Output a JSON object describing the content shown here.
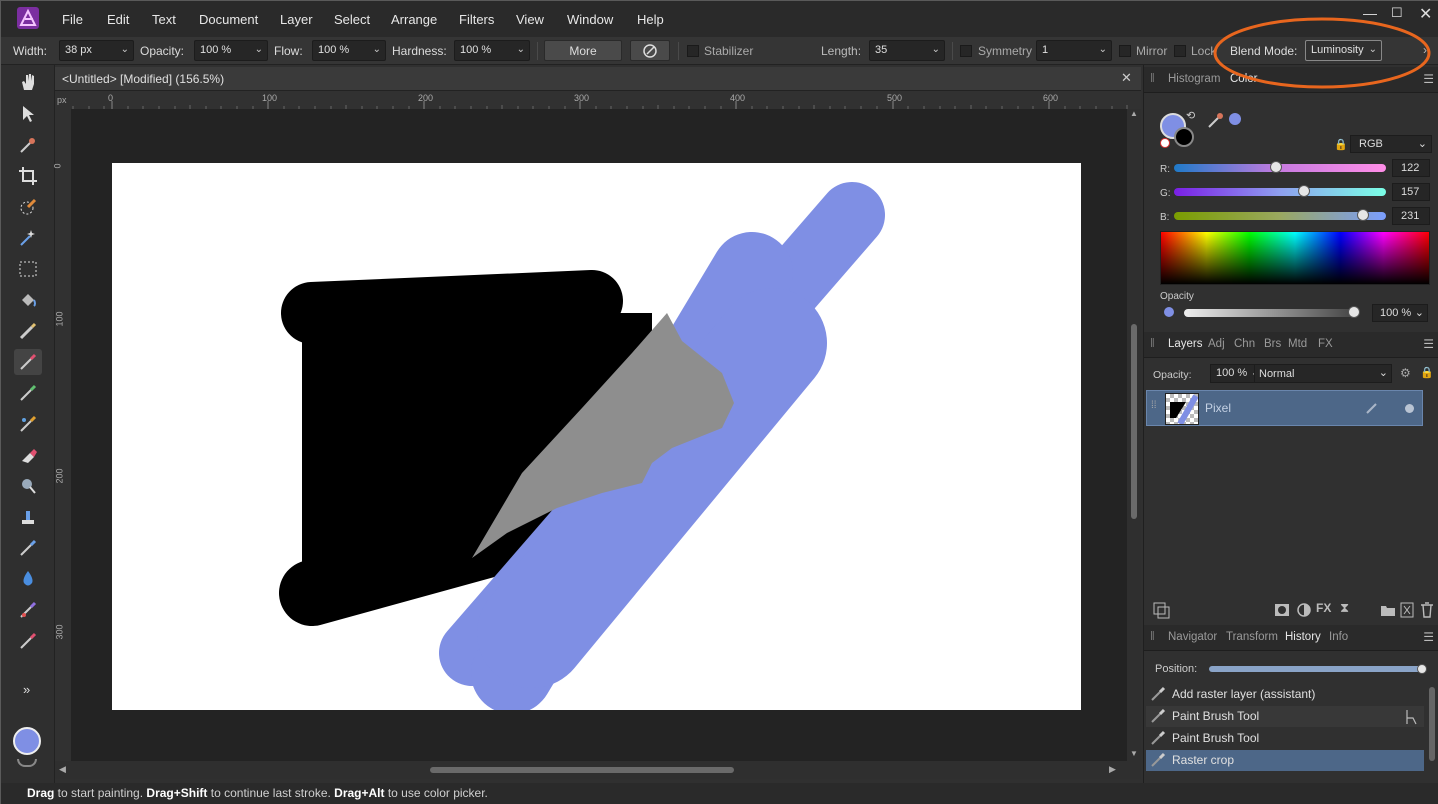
{
  "menubar": {
    "items": [
      "File",
      "Edit",
      "Text",
      "Document",
      "Layer",
      "Select",
      "Arrange",
      "Filters",
      "View",
      "Window",
      "Help"
    ],
    "mnemonics": [
      "F",
      "E",
      "T",
      "D",
      "L",
      "S",
      "A",
      "i",
      "V",
      "W",
      "H"
    ]
  },
  "context": {
    "width_label": "Width:",
    "width_value": "38 px",
    "opacity_label": "Opacity:",
    "opacity_value": "100 %",
    "flow_label": "Flow:",
    "flow_value": "100 %",
    "hardness_label": "Hardness:",
    "hardness_value": "100 %",
    "more_label": "More",
    "stabilizer_label": "Stabilizer",
    "length_label": "Length:",
    "length_value": "35",
    "symmetry_label": "Symmetry",
    "symmetry_value": "1",
    "mirror_label": "Mirror",
    "lock_label": "Lock",
    "blendmode_label": "Blend Mode:",
    "blendmode_value": "Luminosity"
  },
  "document": {
    "tab_title": "<Untitled> [Modified] (156.5%)",
    "ruler_unit": "px",
    "h_ticks": [
      "0",
      "100",
      "200",
      "300",
      "400",
      "500",
      "600"
    ],
    "v_ticks": [
      "0",
      "100",
      "200",
      "300"
    ]
  },
  "color_panel": {
    "tabs": [
      "Histogram",
      "Color"
    ],
    "active_tab": "Color",
    "model": "RGB",
    "r_label": "R:",
    "r_value": "122",
    "g_label": "G:",
    "g_value": "157",
    "b_label": "B:",
    "b_value": "231",
    "opacity_label": "Opacity",
    "opacity_value": "100 %",
    "fill_color": "#7a9de7"
  },
  "layers_panel": {
    "tabs": [
      "Layers",
      "Adj",
      "Chn",
      "Brs",
      "Mtd",
      "FX"
    ],
    "opacity_label": "Opacity:",
    "opacity_value": "100 %",
    "blend_value": "Normal",
    "layer_name": "Pixel"
  },
  "history_panel": {
    "tabs": [
      "Navigator",
      "Transform",
      "History",
      "Info"
    ],
    "position_label": "Position:",
    "items": [
      "Add raster layer (assistant)",
      "Paint Brush Tool",
      "Paint Brush Tool",
      "Raster crop"
    ],
    "selected_index": 3
  },
  "status": {
    "s1": "Drag",
    "s2": " to start painting. ",
    "s3": "Drag+Shift",
    "s4": " to continue last stroke. ",
    "s5": "Drag+Alt",
    "s6": " to use color picker."
  },
  "colors": {
    "brush_blue": "#7f8fe4",
    "gray_luminosity": "#8e8e8e",
    "highlight_orange": "#e8661e"
  }
}
